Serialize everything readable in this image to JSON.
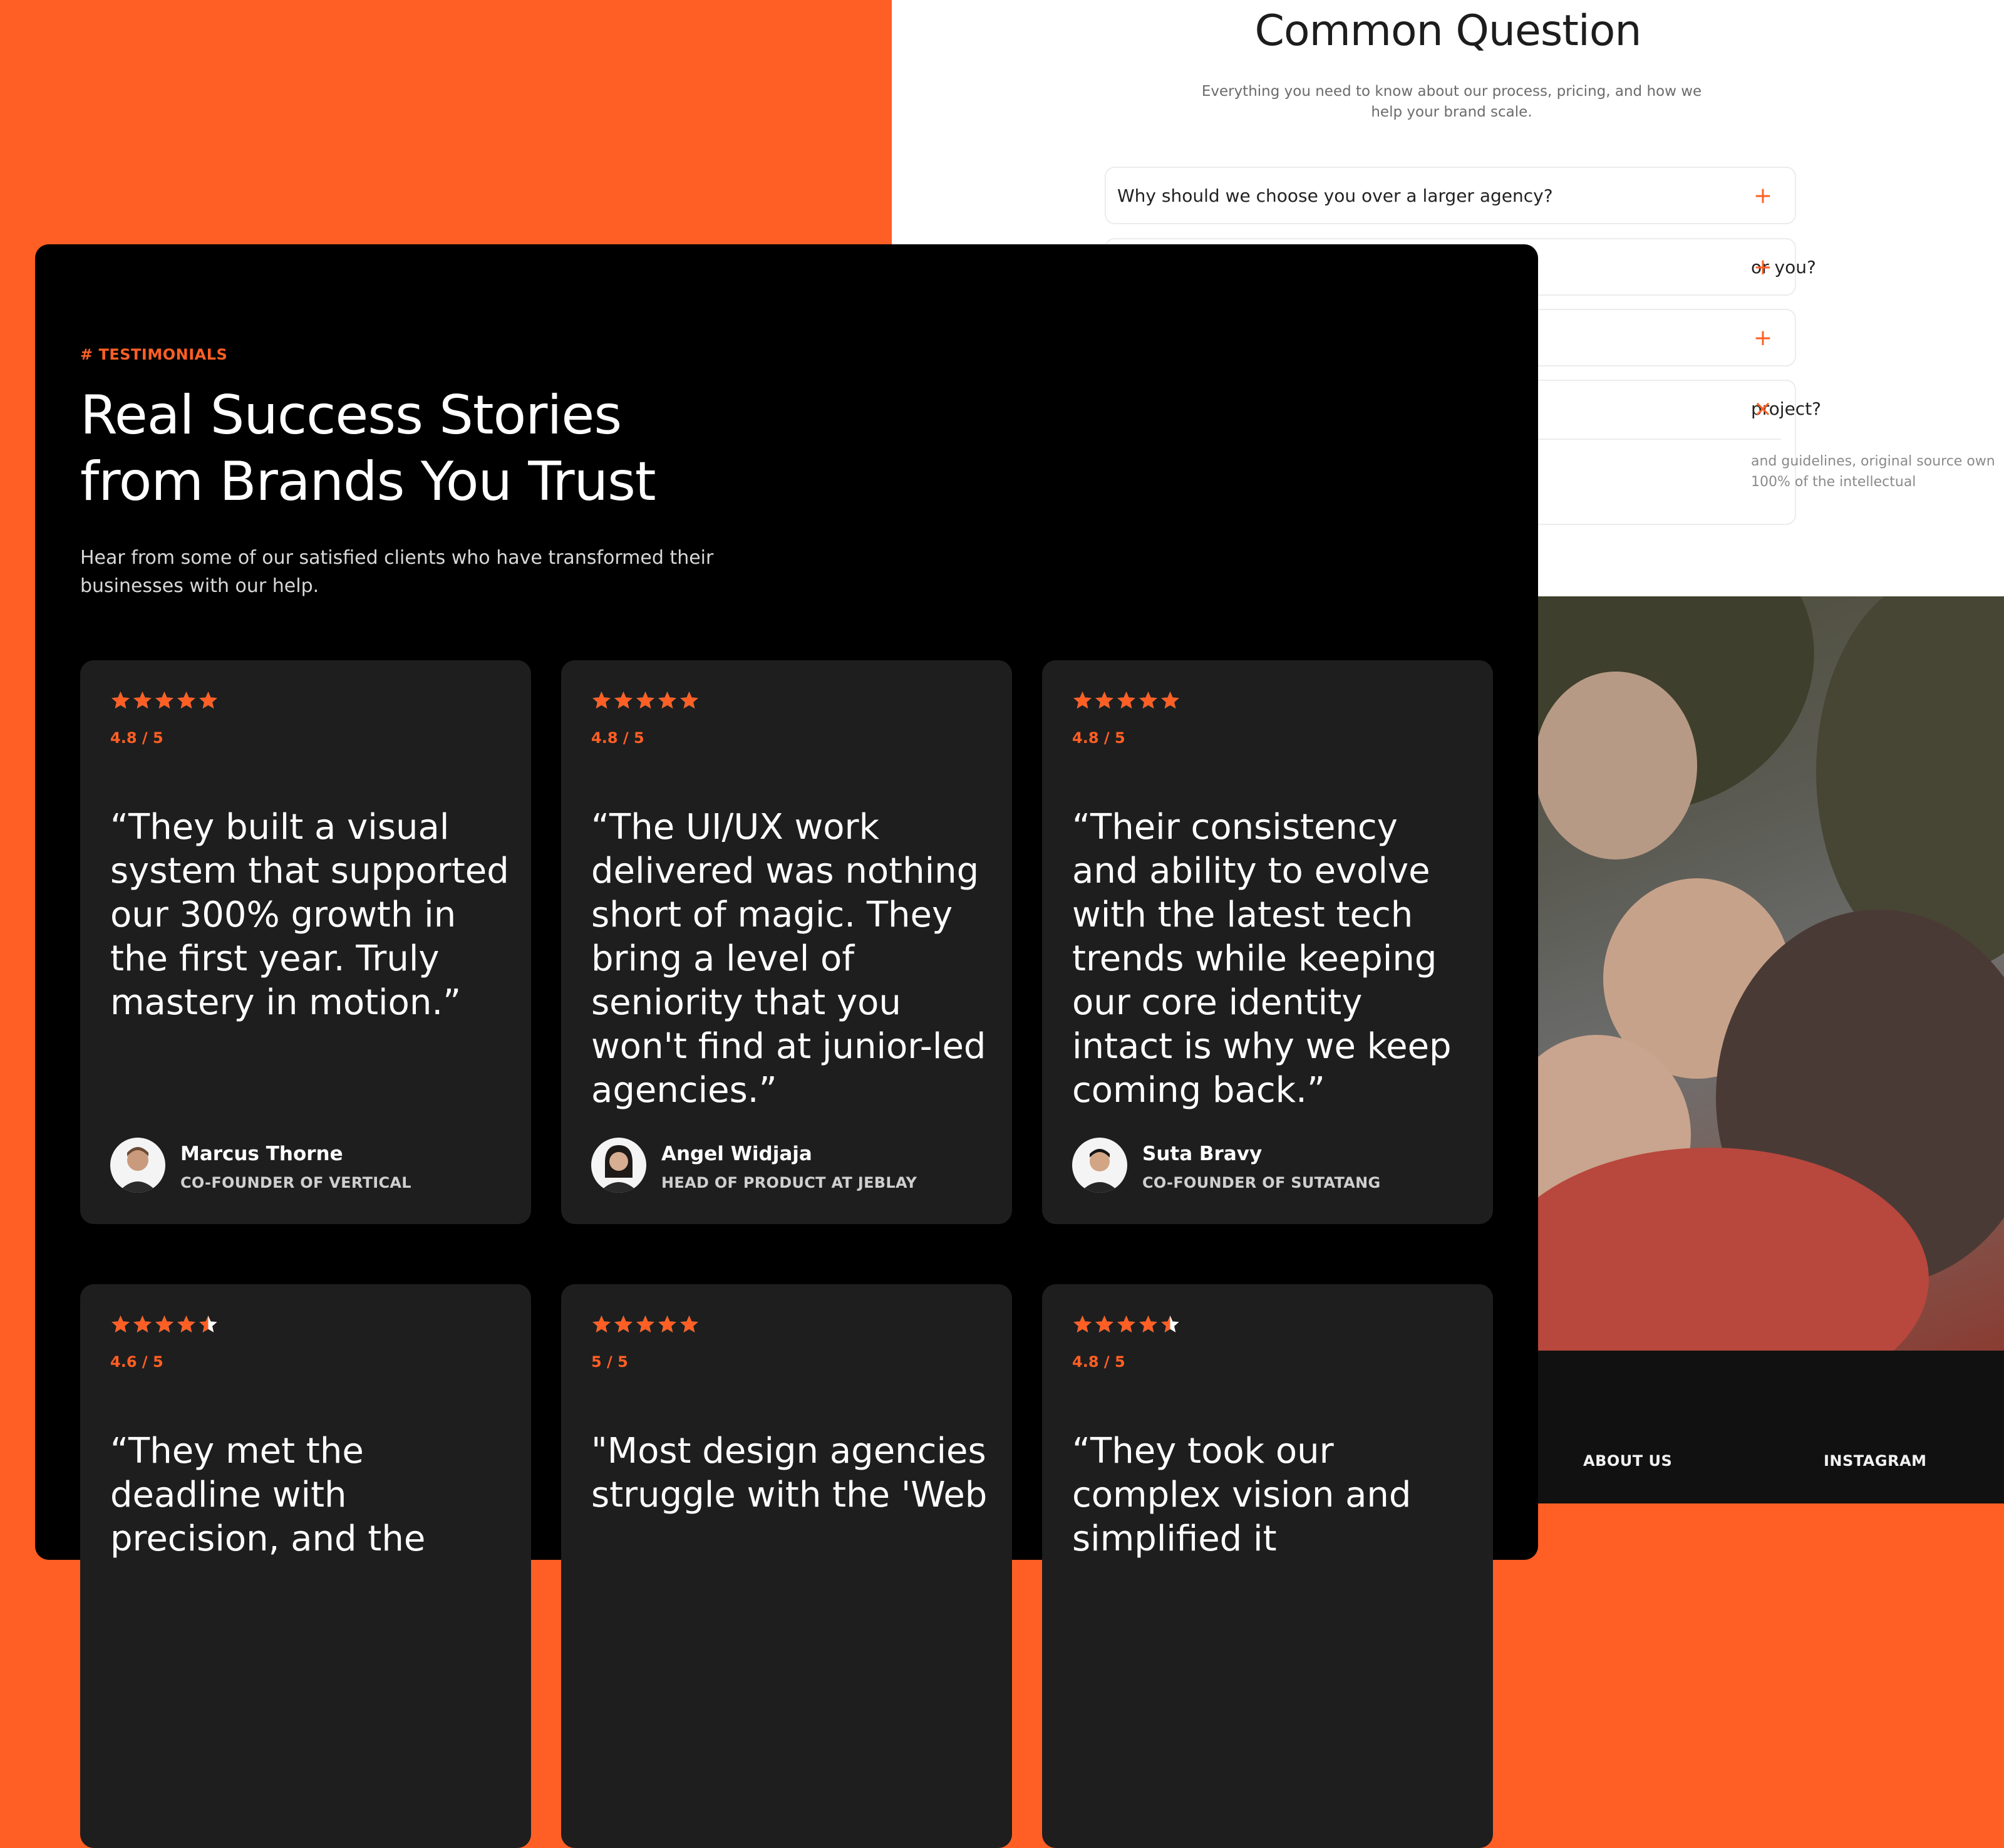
{
  "faq": {
    "title": "Common Question",
    "subtitle": "Everything you need to know about our process, pricing, and how we help your brand scale.",
    "items": [
      {
        "question": "Why should we choose you over a larger agency?",
        "icon": "+"
      },
      {
        "question": "or you?",
        "icon": "+"
      },
      {
        "question": "",
        "icon": "+"
      },
      {
        "question": "project?",
        "icon": "×",
        "answer": "and guidelines, original source own 100% of the intellectual"
      }
    ]
  },
  "testimonials": {
    "eyebrow": "# TESTIMONIALS",
    "headline_line1": "Real Success Stories",
    "headline_line2": "from Brands You Trust",
    "intro": "Hear from some of our satisfied clients who have transformed their businesses with our help.",
    "cards": [
      {
        "stars": 5,
        "rating": "4.8 / 5",
        "quote": "“They built a visual system that supported our 300% growth in the first year. Truly mastery in motion.”",
        "name": "Marcus Thorne",
        "role": "CO-FOUNDER OF VERTICAL"
      },
      {
        "stars": 5,
        "rating": "4.8 / 5",
        "quote": "“The UI/UX work delivered was nothing short of magic. They bring a level of seniority that you won't find at junior-led agencies.”",
        "name": "Angel Widjaja",
        "role": "HEAD OF PRODUCT AT JEBLAY"
      },
      {
        "stars": 5,
        "rating": "4.8 / 5",
        "quote": "“Their consistency and ability to evolve with the latest tech trends while keeping our core identity intact is why we keep coming back.”",
        "name": "Suta Bravy",
        "role": "CO-FOUNDER OF SUTATANG"
      },
      {
        "stars": 4.5,
        "rating": "4.6 / 5",
        "quote": "“They met the deadline with precision, and the"
      },
      {
        "stars": 5,
        "rating": "5 / 5",
        "quote": "\"Most design agencies struggle with the 'Web"
      },
      {
        "stars": 4.5,
        "rating": "4.8 / 5",
        "quote": "“They took our complex vision and simplified it"
      }
    ]
  },
  "footer": {
    "links": [
      "ABOUT US",
      "INSTAGRAM"
    ]
  },
  "colors": {
    "accent": "#ff5f24",
    "panel": "#000000",
    "card": "#1e1e1e",
    "white": "#ffffff"
  }
}
